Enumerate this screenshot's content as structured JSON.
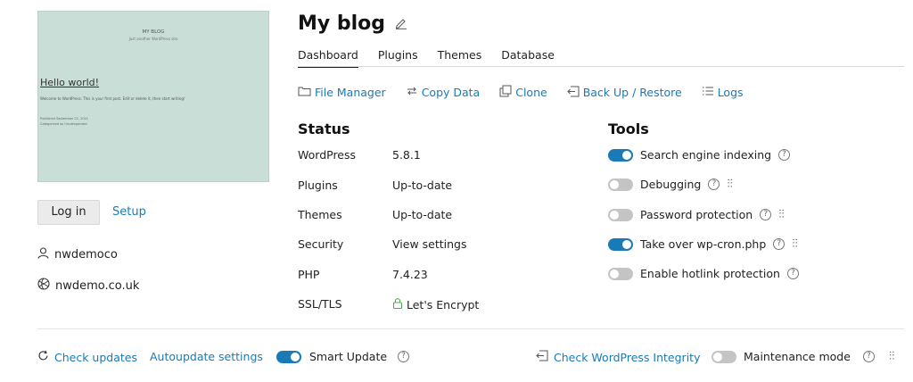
{
  "preview": {
    "site_name": "MY BLOG",
    "tagline": "Just another WordPress site",
    "post_title": "Hello world!",
    "post_text": "Welcome to WordPress. This is your first post. Edit or delete it, then start writing!",
    "meta1": "Published September 22, 2021",
    "meta2": "Categorized as Uncategorized"
  },
  "left": {
    "login_label": "Log in",
    "setup_label": "Setup",
    "username": "nwdemoco",
    "domain": "nwdemo.co.uk"
  },
  "header": {
    "title": "My blog"
  },
  "tabs": [
    "Dashboard",
    "Plugins",
    "Themes",
    "Database"
  ],
  "actions": {
    "file_manager": "File Manager",
    "copy_data": "Copy Data",
    "clone": "Clone",
    "backup": "Back Up / Restore",
    "logs": "Logs"
  },
  "status": {
    "heading": "Status",
    "rows": [
      {
        "key": "WordPress",
        "value": "5.8.1"
      },
      {
        "key": "Plugins",
        "value": "Up-to-date"
      },
      {
        "key": "Themes",
        "value": "Up-to-date"
      },
      {
        "key": "Security",
        "value": "View settings"
      },
      {
        "key": "PHP",
        "value": "7.4.23"
      },
      {
        "key": "SSL/TLS",
        "value": "Let's Encrypt"
      }
    ]
  },
  "tools": {
    "heading": "Tools",
    "items": [
      {
        "label": "Search engine indexing",
        "on": true
      },
      {
        "label": "Debugging",
        "on": false
      },
      {
        "label": "Password protection",
        "on": false
      },
      {
        "label": "Take over wp-cron.php",
        "on": true
      },
      {
        "label": "Enable hotlink protection",
        "on": false
      }
    ]
  },
  "bottom": {
    "check_updates": "Check updates",
    "autoupdate": "Autoupdate settings",
    "smart_update": "Smart Update",
    "integrity": "Check WordPress Integrity",
    "maintenance": "Maintenance mode"
  },
  "help_glyph": "?",
  "sliders_glyph": "⫶⫶",
  "colors": {
    "accent": "#1a7ab5",
    "toggle_off": "#c4c4c4",
    "preview_bg": "#c9ded7",
    "ssl_green": "#4caf50"
  }
}
